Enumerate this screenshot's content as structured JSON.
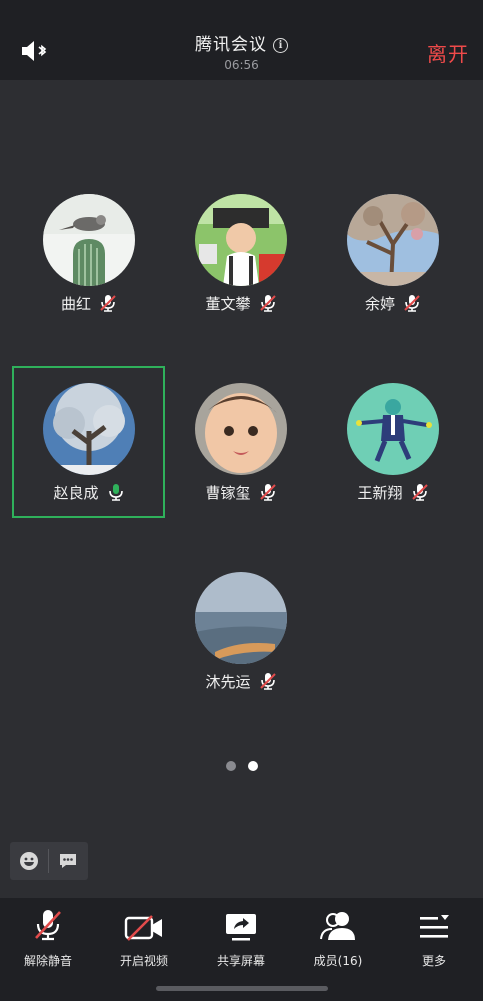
{
  "header": {
    "title": "腾讯会议",
    "time": "06:56",
    "leave_label": "离开",
    "icons": [
      "speaker-bluetooth-icon",
      "info-icon"
    ],
    "leave_color": "#ef4a4a"
  },
  "members": [
    {
      "name": "曲红",
      "mic": "muted",
      "avatar": "bird"
    },
    {
      "name": "董文攀",
      "mic": "muted",
      "avatar": "child-photo"
    },
    {
      "name": "余婷",
      "mic": "muted",
      "avatar": "tree-sky"
    },
    {
      "name": "赵良成",
      "mic": "active",
      "avatar": "snowy-tree",
      "speaking": true
    },
    {
      "name": "曹镓玺",
      "mic": "muted",
      "avatar": "baby-face"
    },
    {
      "name": "王新翔",
      "mic": "muted",
      "avatar": "cartoon-figure"
    },
    {
      "name": "沐先运",
      "mic": "muted",
      "avatar": "sea-view"
    }
  ],
  "pager": {
    "pages": 2,
    "current": 2
  },
  "toolbar": {
    "unmute_label": "解除静音",
    "video_label": "开启视频",
    "share_label": "共享屏幕",
    "members_label": "成员(16)",
    "more_label": "更多"
  },
  "colors": {
    "accent_green": "#2fb15b",
    "muted_red": "#e24b4b",
    "bar_bg": "#1f2024",
    "page_bg": "#2d2e32"
  }
}
